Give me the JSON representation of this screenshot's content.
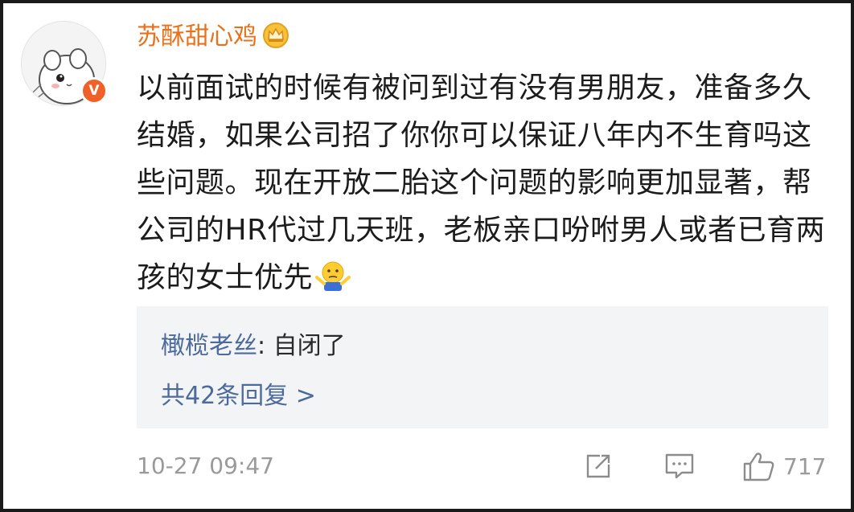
{
  "post": {
    "username": "苏酥甜心鸡",
    "verified_badge": "V",
    "crown_icon": "crown-icon",
    "comment_text": "以前面试的时候有被问到过有没有男朋友，准备多久结婚，如果公司招了你你可以保证八年内不生育吗这些问题。现在开放二胎这个问题的影响更加显著，帮公司的HR代过几天班，老板亲口吩咐男人或者已育两孩的女士优先",
    "emoji": "shrug-emoji"
  },
  "reply": {
    "user": "橄榄老丝",
    "separator": ": ",
    "text": "自闭了",
    "count_label": "共42条回复 >"
  },
  "footer": {
    "timestamp": "10-27 09:47",
    "like_count": "717"
  },
  "colors": {
    "username": "#e8721c",
    "link_blue": "#4c6a9b",
    "muted": "#9a9a9a",
    "badge": "#f0612a",
    "reply_bg": "#f3f4f6"
  }
}
